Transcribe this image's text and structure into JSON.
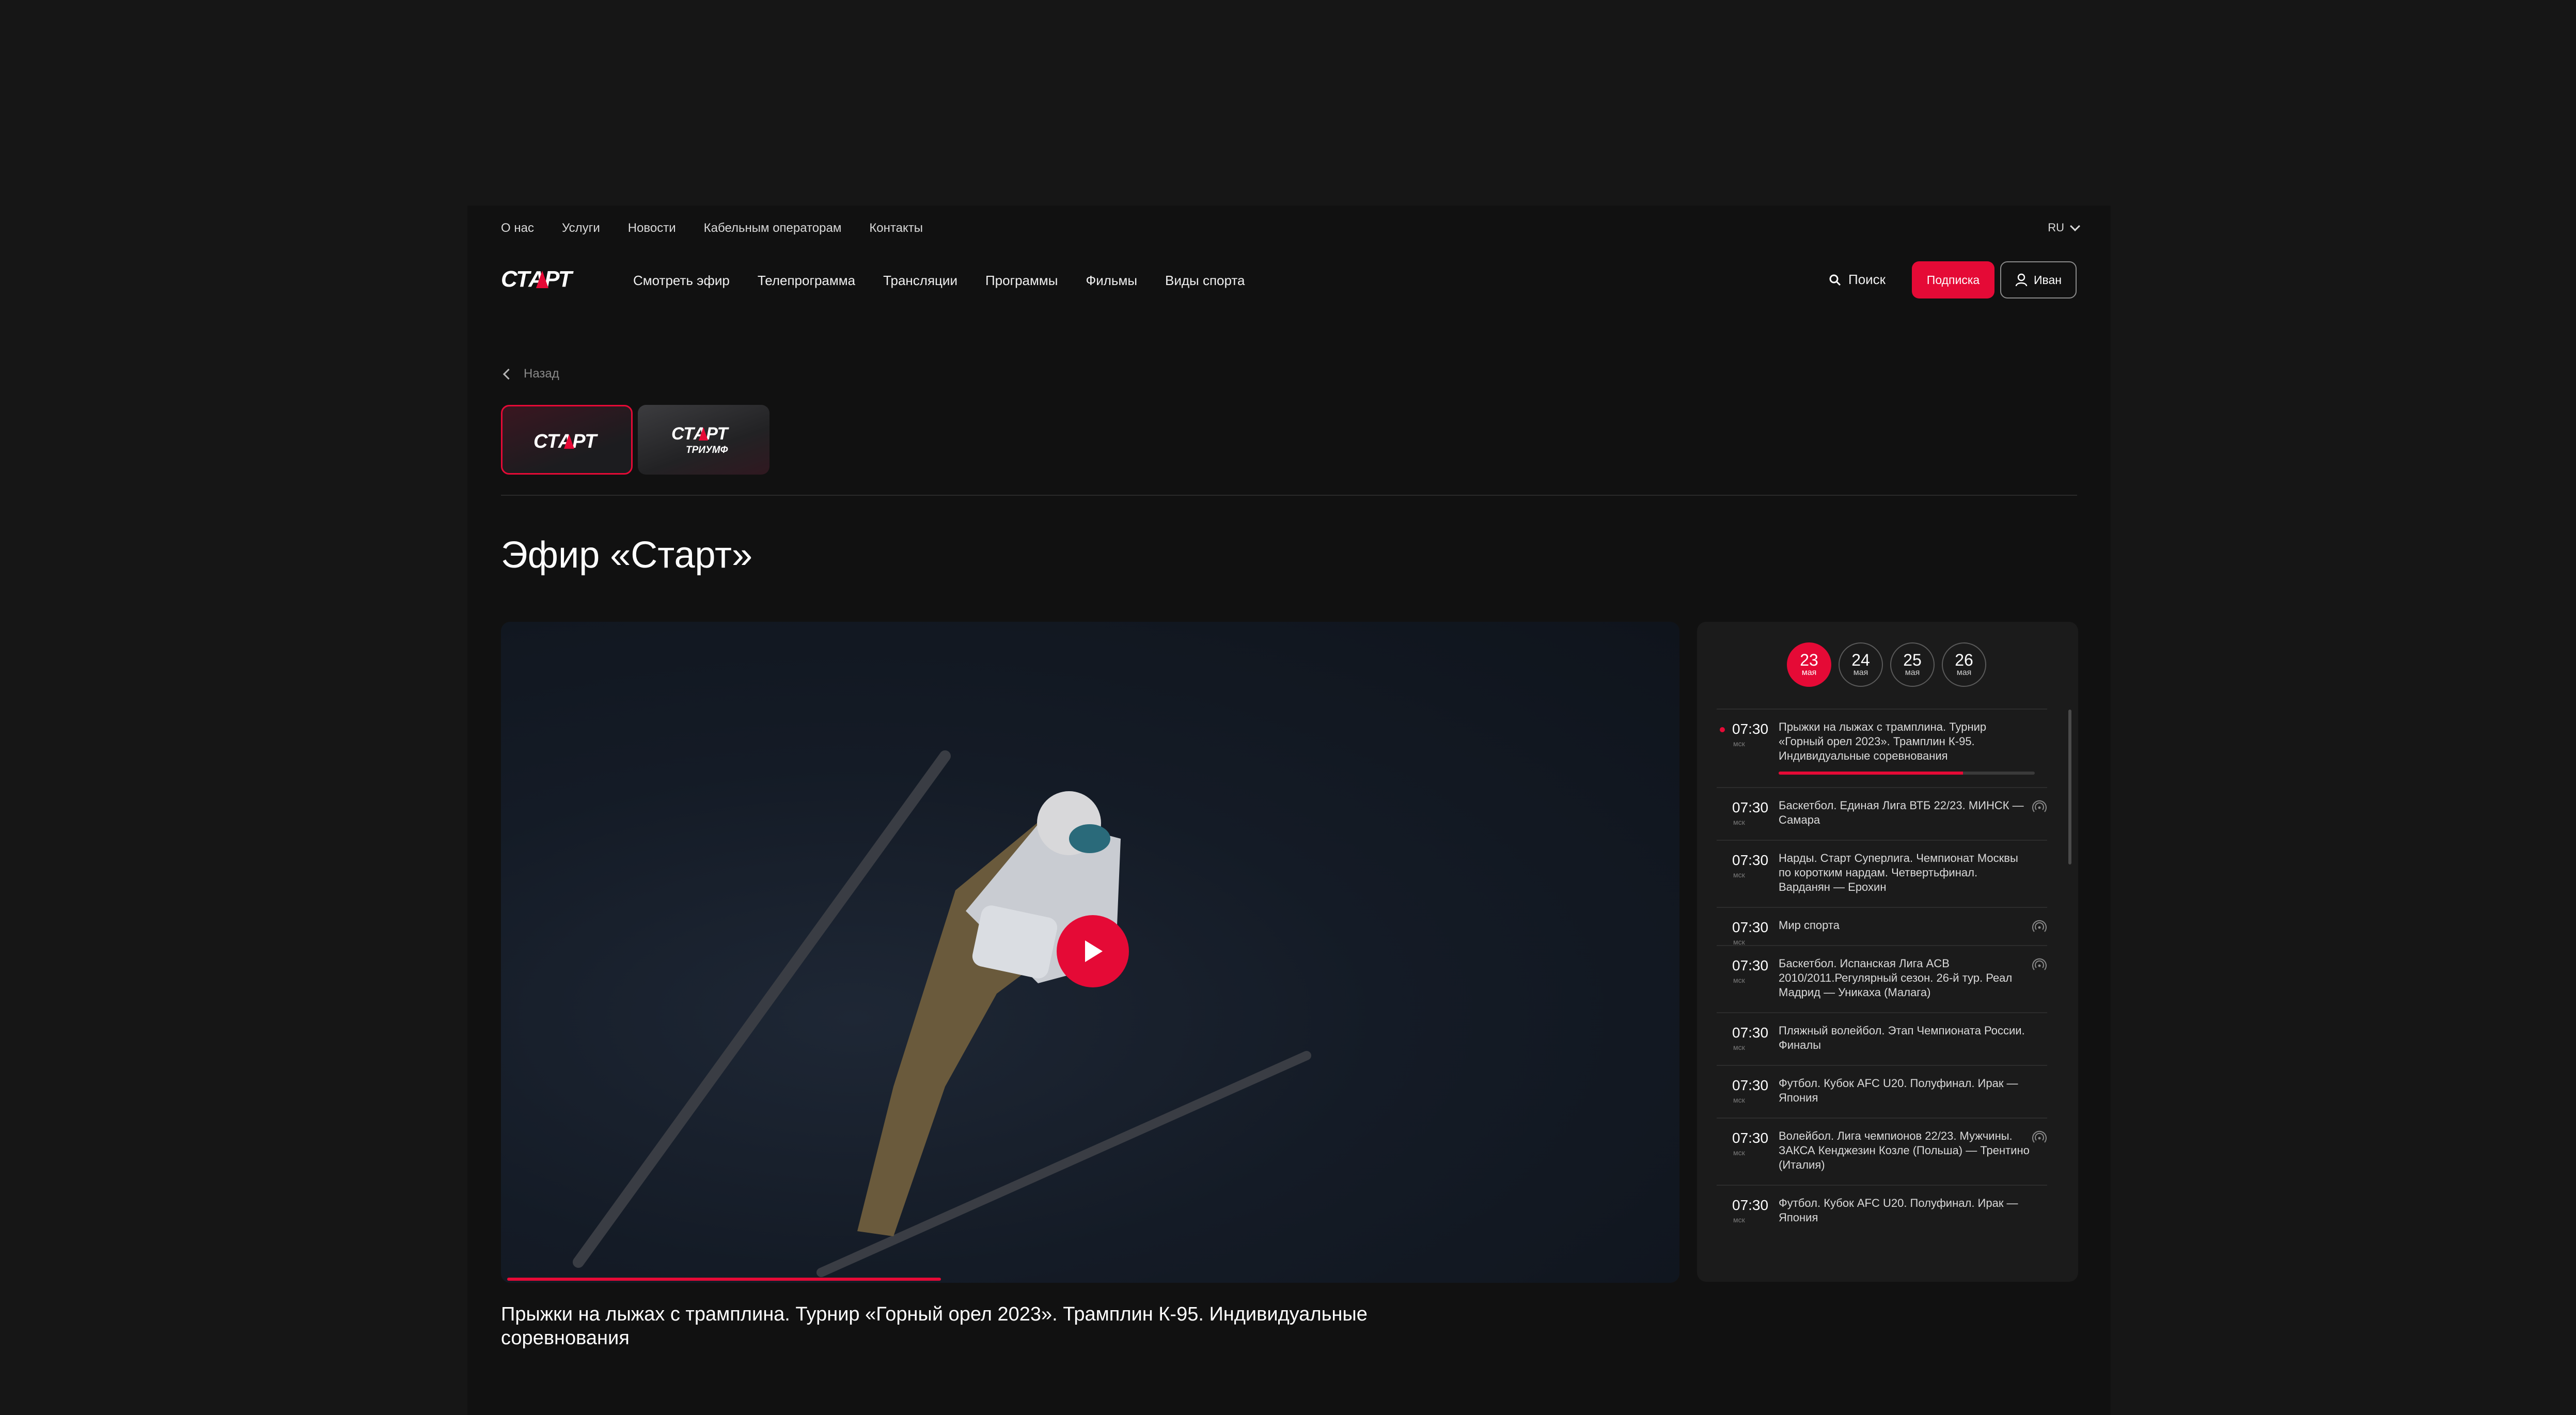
{
  "top_links": [
    "О нас",
    "Услуги",
    "Новости",
    "Кабельным операторам",
    "Контакты"
  ],
  "lang": "RU",
  "logo_text": "СТАРТ",
  "nav_links": [
    "Смотреть эфир",
    "Телепрограмма",
    "Трансляции",
    "Программы",
    "Фильмы",
    "Виды спорта"
  ],
  "search_label": "Поиск",
  "subscribe_label": "Подписка",
  "user_name": "Иван",
  "back_label": "Назад",
  "channels": [
    {
      "name": "СТАРТ",
      "subtitle": "",
      "active": true
    },
    {
      "name": "СТАРТ",
      "subtitle": "ТРИУМФ",
      "active": false
    }
  ],
  "page_title": "Эфир «Старт»",
  "video": {
    "caption": "Прыжки на лыжах с трамплина. Турнир «Горный орел 2023». Трамплин К-95. Индивидуальные соревнования",
    "progress": 0.37
  },
  "dates": [
    {
      "day": "23",
      "month": "мая",
      "active": true
    },
    {
      "day": "24",
      "month": "мая",
      "active": false
    },
    {
      "day": "25",
      "month": "мая",
      "active": false
    },
    {
      "day": "26",
      "month": "мая",
      "active": false
    }
  ],
  "schedule": [
    {
      "time": "07:30",
      "tz": "мск",
      "title": "Прыжки на лыжах с трамплина. Турнир «Горный орел 2023». Трамплин К-95. Индивидуальные соревнования",
      "live": true,
      "progress": 0.72,
      "broadcast_icon": false
    },
    {
      "time": "07:30",
      "tz": "мск",
      "title": "Баскетбол. Единая Лига ВТБ 22/23. МИНСК — Самара",
      "live": false,
      "broadcast_icon": true
    },
    {
      "time": "07:30",
      "tz": "мск",
      "title": "Нарды. Старт Суперлига. Чемпионат Москвы по коротким нардам. Четвертьфинал. Варданян — Ерохин",
      "live": false,
      "broadcast_icon": false
    },
    {
      "time": "07:30",
      "tz": "мск",
      "title": "Мир спорта",
      "live": false,
      "broadcast_icon": true
    },
    {
      "time": "07:30",
      "tz": "мск",
      "title": "Баскетбол. Испанская Лига ACB 2010/2011.Регулярный сезон. 26-й тур. Реал Мадрид — Уникаха (Малага)",
      "live": false,
      "broadcast_icon": true
    },
    {
      "time": "07:30",
      "tz": "мск",
      "title": "Пляжный волейбол. Этап Чемпионата России. Финалы",
      "live": false,
      "broadcast_icon": false
    },
    {
      "time": "07:30",
      "tz": "мск",
      "title": "Футбол. Кубок AFC U20. Полуфинал. Ирак — Япония",
      "live": false,
      "broadcast_icon": false
    },
    {
      "time": "07:30",
      "tz": "мск",
      "title": "Волейбол. Лига чемпионов 22/23. Мужчины. ЗАКСА Кенджезин Козле (Польша) — Трентино (Италия)",
      "live": false,
      "broadcast_icon": true
    },
    {
      "time": "07:30",
      "tz": "мск",
      "title": "Футбол. Кубок AFC U20. Полуфинал. Ирак — Япония",
      "live": false,
      "broadcast_icon": false
    }
  ],
  "colors": {
    "accent": "#e50a36",
    "background": "#111111",
    "panel": "#1b1b1b"
  }
}
